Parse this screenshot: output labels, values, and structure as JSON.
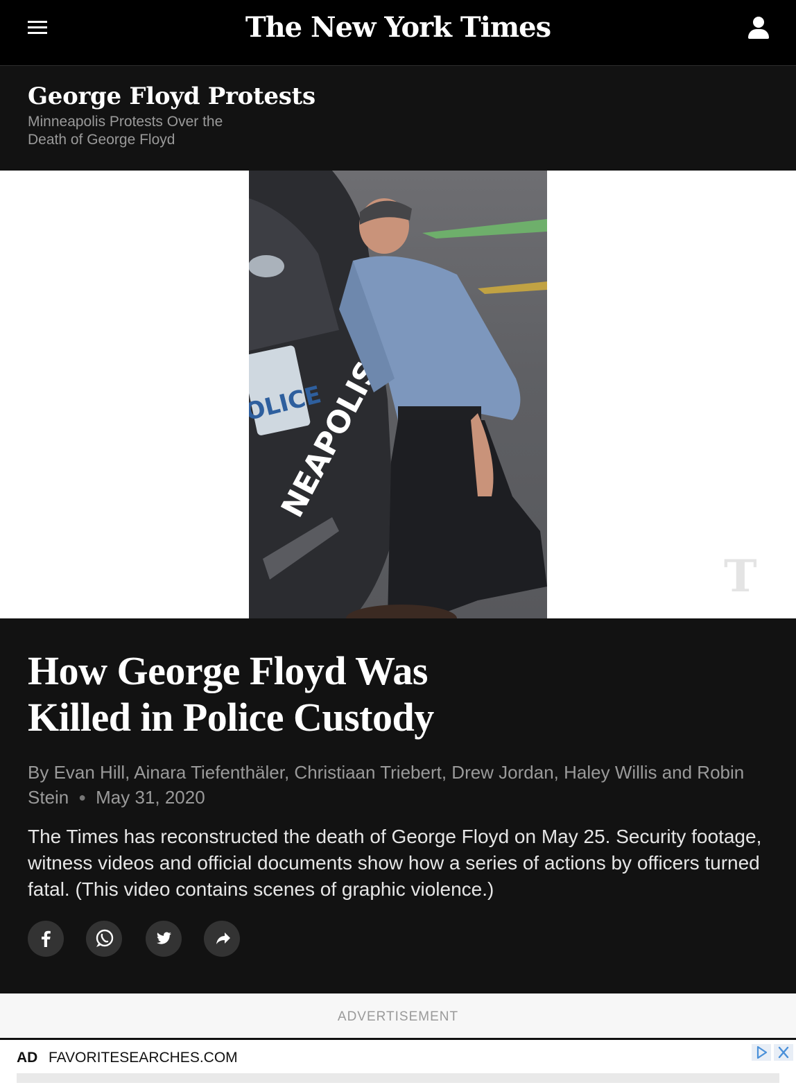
{
  "header": {
    "masthead": "The New York Times",
    "icons": {
      "menu": "hamburger-menu-icon",
      "account": "user-icon"
    }
  },
  "section": {
    "title": "George Floyd Protests",
    "subtitle": "Minneapolis Protests Over the Death of George Floyd"
  },
  "media": {
    "watermark": "T",
    "scene_text": {
      "plate": "OLICE",
      "vehicle": "NEAPOLIS"
    }
  },
  "article": {
    "headline": "How George Floyd Was Killed in Police Custody",
    "byline": "By Evan Hill, Ainara Tiefenthäler, Christiaan Triebert, Drew Jordan, Haley Willis and Robin Stein",
    "date": "May 31, 2020",
    "summary": "The Times has reconstructed the death of George Floyd on May 25. Security footage, witness videos and official documents show how a series of actions by officers turned fatal. (This video contains scenes of graphic violence.)",
    "share_icons": [
      "facebook-icon",
      "whatsapp-icon",
      "twitter-icon",
      "share-icon"
    ]
  },
  "advertisement": {
    "label": "ADVERTISEMENT",
    "tag": "AD",
    "domain": "FAVORITESEARCHES.COM"
  },
  "colors": {
    "header_bg": "#000000",
    "section_bg": "#121212",
    "article_bg": "#121212",
    "byline": "#9a9a9a",
    "button_bg": "#333333"
  }
}
